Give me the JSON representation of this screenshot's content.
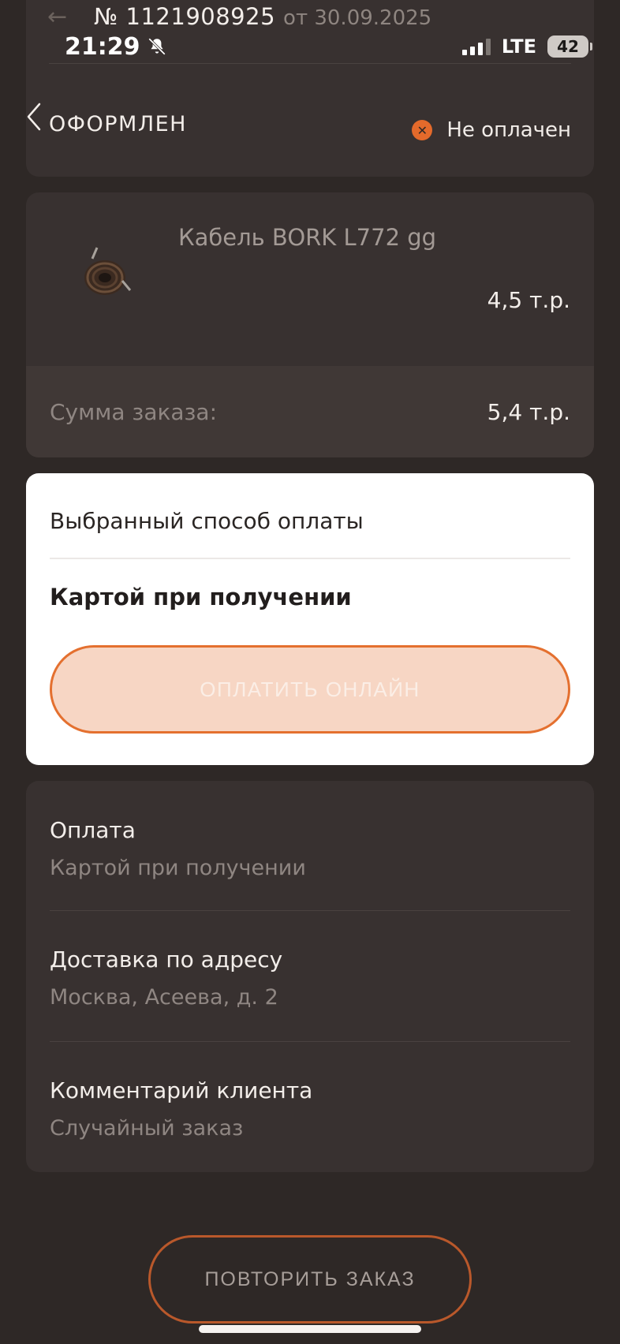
{
  "header": {
    "order_number": "№ 1121908925",
    "order_date": "от 30.09.2025"
  },
  "status_bar": {
    "time": "21:29",
    "network": "LTE",
    "battery": "42"
  },
  "order": {
    "status": "ОФОРМЛЕН",
    "payment_status": "Не оплачен"
  },
  "product": {
    "name": "Кабель BORK L772 gg",
    "price": "4,5 т.р."
  },
  "summary": {
    "label": "Сумма заказа:",
    "value": "5,4 т.р."
  },
  "payment_card": {
    "title": "Выбранный способ оплаты",
    "method": "Картой при получении",
    "pay_online_label": "ОПЛАТИТЬ ОНЛАЙН"
  },
  "details": [
    {
      "title": "Оплата",
      "value": "Картой при получении"
    },
    {
      "title": "Доставка по адресу",
      "value": "Москва, Асеева, д. 2"
    },
    {
      "title": "Комментарий клиента",
      "value": "Случайный заказ"
    }
  ],
  "actions": {
    "repeat_label": "ПОВТОРИТЬ ЗАКАЗ"
  },
  "colors": {
    "accent": "#e4702f",
    "background": "#2e2826",
    "card": "#383130"
  }
}
